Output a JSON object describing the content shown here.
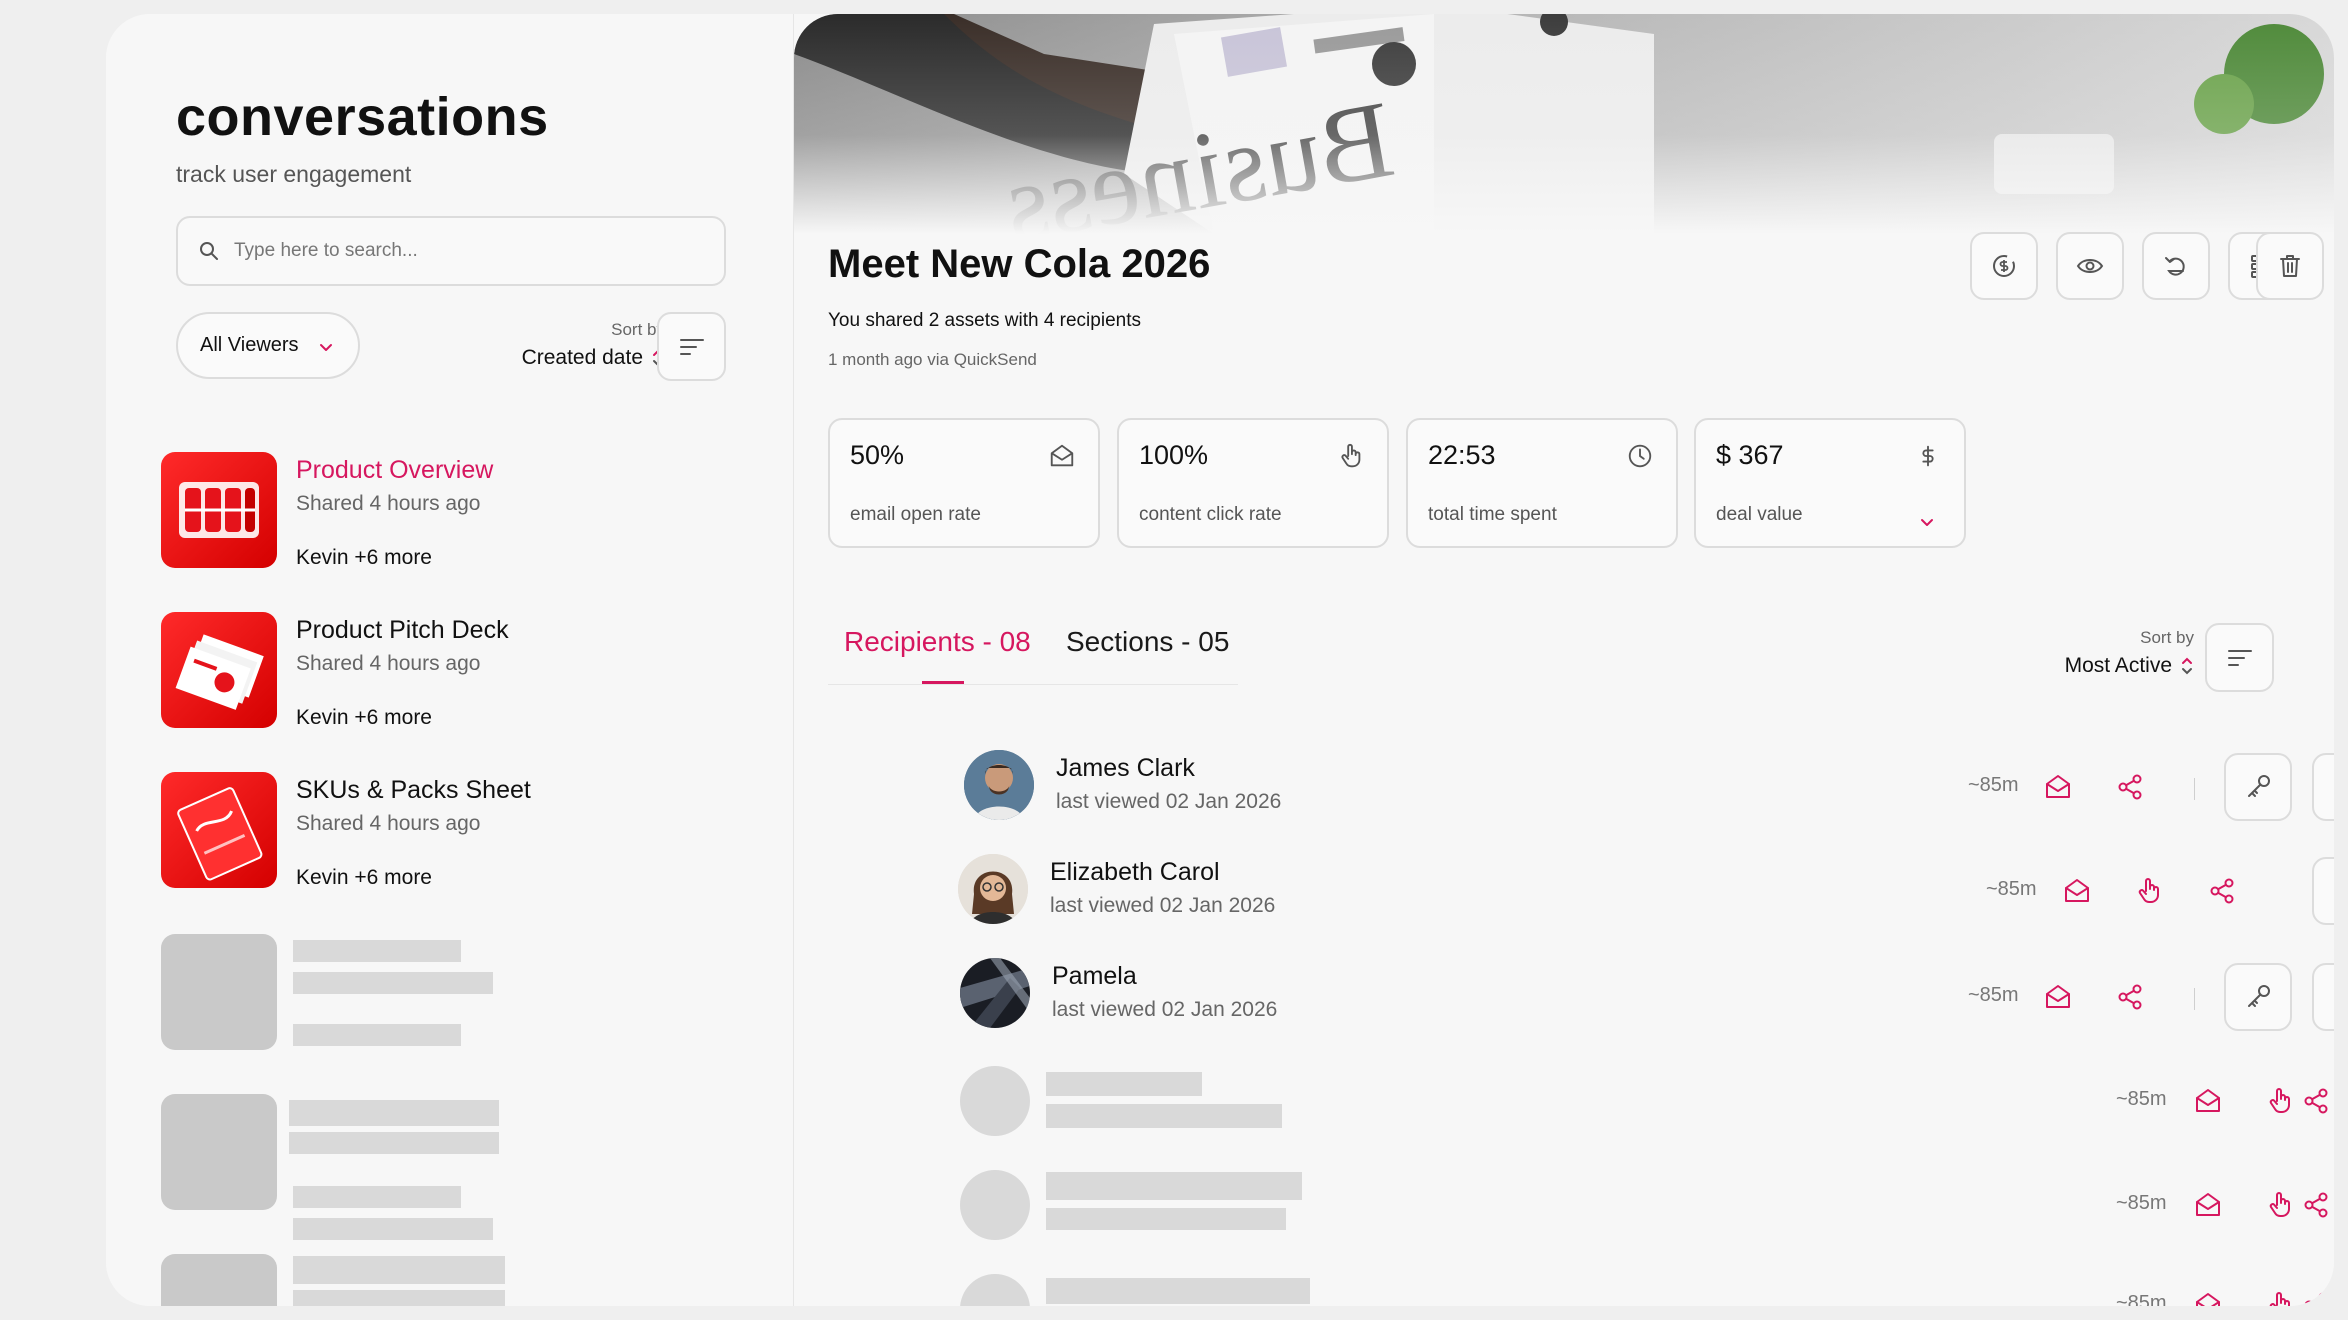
{
  "sidebar": {
    "title": "conversations",
    "subtitle": "track user engagement",
    "search_placeholder": "Type here to search...",
    "filter_label": "All Viewers",
    "sort_label": "Sort by",
    "sort_value": "Created date",
    "assets": [
      {
        "name": "Product Overview",
        "shared": "Shared 4 hours ago",
        "recipients": "Kevin +6 more",
        "active": true
      },
      {
        "name": "Product Pitch Deck",
        "shared": "Shared 4 hours ago",
        "recipients": "Kevin +6 more",
        "active": false
      },
      {
        "name": "SKUs & Packs Sheet",
        "shared": "Shared 4 hours ago",
        "recipients": "Kevin +6 more",
        "active": false
      }
    ]
  },
  "main": {
    "title": "Meet New Cola 2026",
    "summary": "You shared 2 assets with 4 recipients",
    "meta": "1 month ago via QuickSend",
    "toolbar_icons": [
      "dollar-refresh-icon",
      "eye-icon",
      "undo-icon",
      "list-icon",
      "trash-icon"
    ],
    "stats": [
      {
        "value": "50%",
        "label": "email open rate",
        "icon": "envelope-open-icon"
      },
      {
        "value": "100%",
        "label": "content click rate",
        "icon": "hand-pointer-icon"
      },
      {
        "value": "22:53",
        "label": "total time spent",
        "icon": "clock-icon"
      },
      {
        "value": "$ 367",
        "label": "deal value",
        "icon": "dollar-icon"
      }
    ],
    "tabs": [
      {
        "label": "Recipients - 08",
        "active": true
      },
      {
        "label": "Sections - 05",
        "active": false
      }
    ],
    "sort_label": "Sort by",
    "sort_value": "Most Active",
    "recipients": [
      {
        "name": "James Clark",
        "last_viewed": "last viewed 02 Jan 2026",
        "duration": "~85m"
      },
      {
        "name": "Elizabeth Carol",
        "last_viewed": "last viewed 02 Jan 2026",
        "duration": "~85m"
      },
      {
        "name": "Pamela",
        "last_viewed": "last viewed 02 Jan 2026",
        "duration": "~85m"
      }
    ],
    "placeholder_durations": [
      "~85m",
      "~85m",
      "~85m"
    ]
  },
  "colors": {
    "accent": "#d6175f",
    "brand_red": "#e5131b"
  }
}
